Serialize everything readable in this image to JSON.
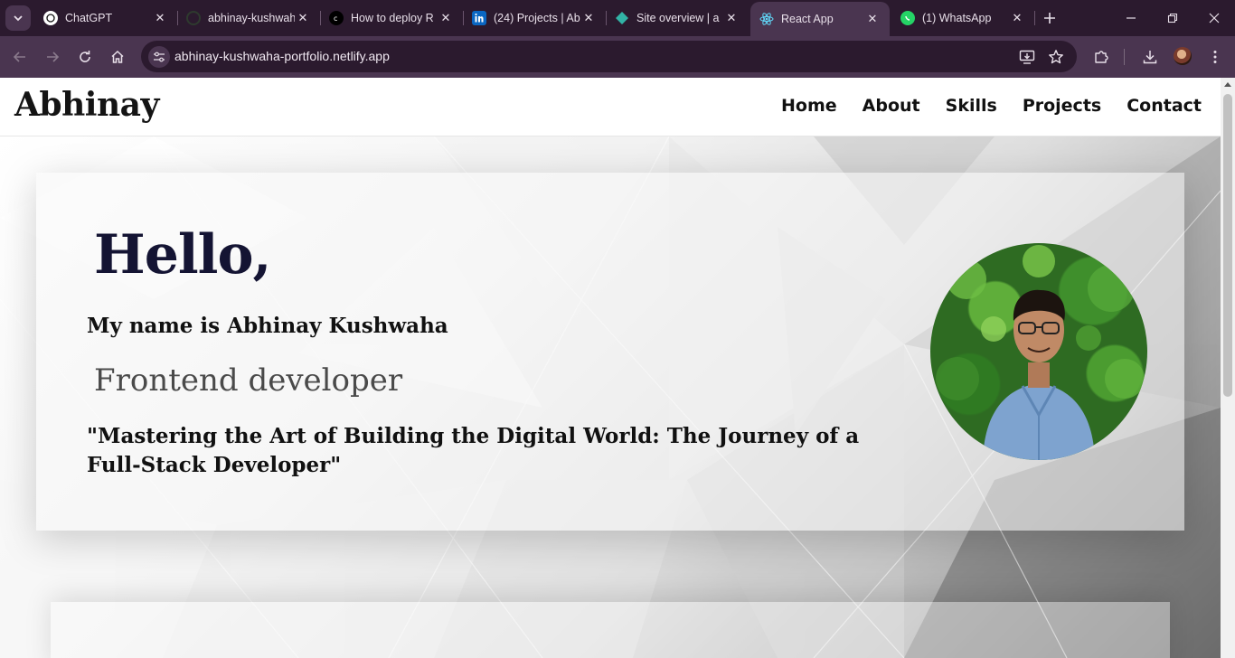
{
  "browser": {
    "tabs": [
      {
        "title": "ChatGPT",
        "icon": "chatgpt-icon"
      },
      {
        "title": "abhinay-kushwaha",
        "icon": "github-icon"
      },
      {
        "title": "How to deploy R",
        "icon": "article-icon"
      },
      {
        "title": "(24) Projects | Ab",
        "icon": "linkedin-icon"
      },
      {
        "title": "Site overview | a",
        "icon": "netlify-icon"
      },
      {
        "title": "React App",
        "icon": "react-icon",
        "active": true
      },
      {
        "title": "(1) WhatsApp",
        "icon": "whatsapp-icon"
      }
    ],
    "url": "abhinay-kushwaha-portfolio.netlify.app",
    "colors": {
      "frame": "#2b1a2e",
      "toolbar": "#4a3550",
      "text": "#e8dfe9"
    }
  },
  "site": {
    "brand": "Abhinay",
    "nav": [
      "Home",
      "About",
      "Skills",
      "Projects",
      "Contact"
    ],
    "hero": {
      "greeting": "Hello,",
      "name_line": "My name is Abhinay Kushwaha",
      "role": "Frontend developer",
      "quote": "\"Mastering the Art of Building the Digital World: The Journey of a Full-Stack Developer\""
    }
  }
}
